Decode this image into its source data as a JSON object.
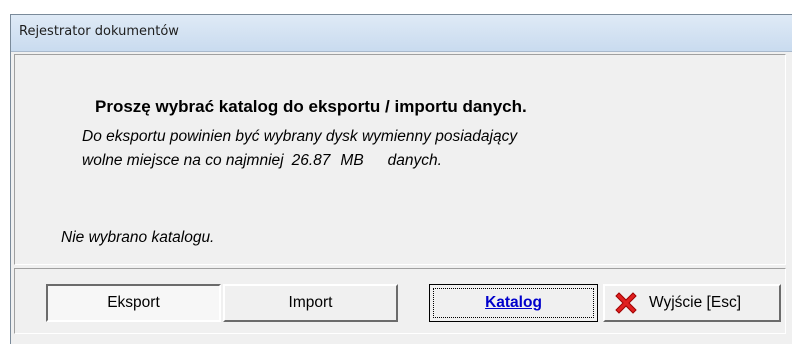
{
  "window": {
    "title": "Rejestrator dokumentów"
  },
  "content": {
    "heading": "Proszę wybrać katalog do eksportu / importu danych.",
    "desc_line1": "Do eksportu powinien być wybrany dysk wymienny posiadający",
    "desc_line2_prefix": "wolne miejsce na co najmniej",
    "desc_size": "26.87",
    "desc_unit": "MB",
    "desc_suffix": "danych.",
    "status": "Nie wybrano katalogu."
  },
  "buttons": {
    "export_label": "Eksport",
    "import_label": "Import",
    "katalog_label": "Katalog",
    "exit_label": "Wyjście [Esc]",
    "exit_icon": "red-x-icon"
  },
  "colors": {
    "accent_link": "#0000cc",
    "exit_icon": "#e02020",
    "titlebar": "#c9dbef"
  }
}
